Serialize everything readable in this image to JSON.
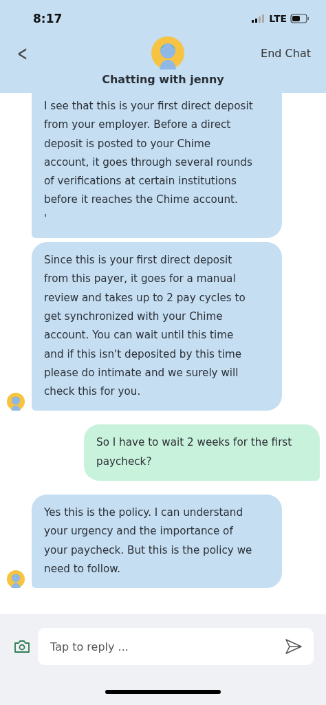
{
  "status_bar": {
    "time": "8:17",
    "network": "LTE"
  },
  "header": {
    "back": "<",
    "action": "End Chat",
    "title": "Chatting with jenny"
  },
  "messages": [
    {
      "kind": "agent",
      "show_avatar": false,
      "lines": [
        "I see that this is your first direct deposit",
        "from your employer. Before a direct",
        "deposit is posted to your Chime",
        "account, it goes through several rounds",
        "of verifications at certain institutions",
        "before it reaches the Chime account.",
        "'"
      ]
    },
    {
      "kind": "agent",
      "show_avatar": true,
      "lines": [
        "Since this is your first direct deposit",
        "from this payer, it goes for a manual",
        "review and takes up to 2 pay cycles to",
        "get synchronized with your Chime",
        "account. You can wait until this time",
        "and if this isn't deposited by this time",
        "please do intimate and we surely will",
        "check this for you."
      ]
    },
    {
      "kind": "user",
      "lines": [
        "So I have to wait 2 weeks for the first",
        "paycheck?"
      ]
    },
    {
      "kind": "agent",
      "show_avatar": true,
      "lines": [
        "Yes this is the policy. I can understand",
        "your urgency and the importance of",
        "your paycheck. But this is the policy we",
        "need to follow."
      ]
    }
  ],
  "composer": {
    "placeholder": "Tap to reply ..."
  }
}
